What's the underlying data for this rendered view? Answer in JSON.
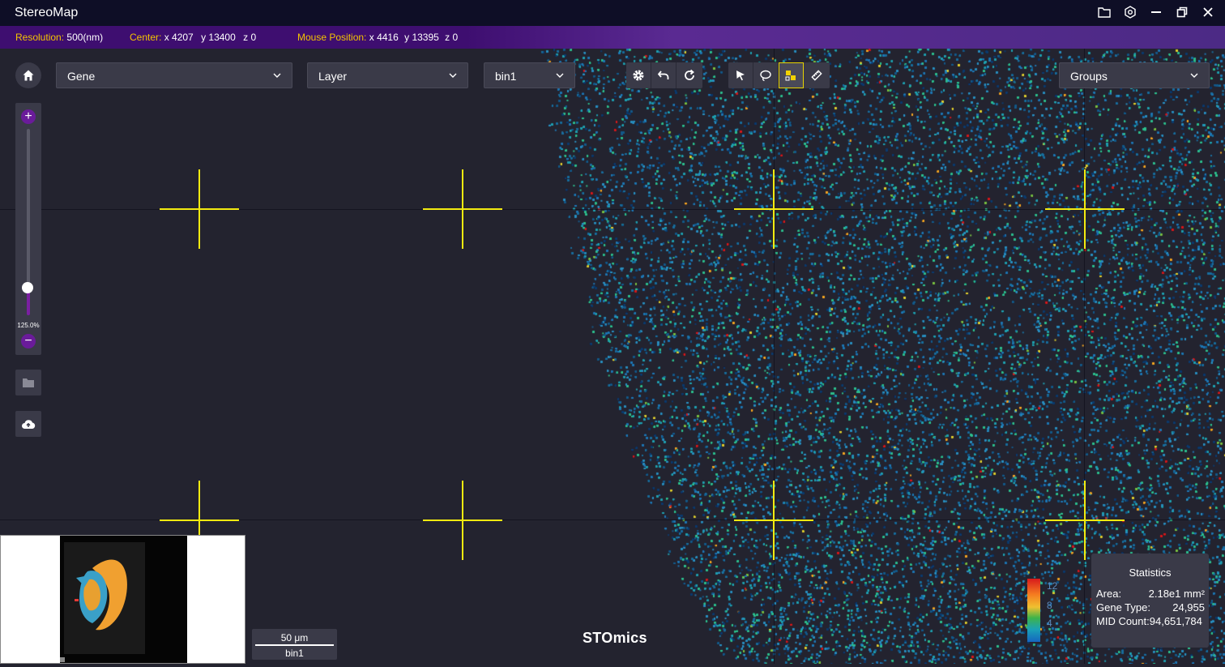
{
  "app": {
    "title": "StereoMap"
  },
  "window_controls": {
    "icons": [
      "folder-icon",
      "settings-icon",
      "minimize-icon",
      "restore-icon",
      "close-icon"
    ]
  },
  "infobar": {
    "resolution_label": "Resolution:",
    "resolution_value": "500(nm)",
    "center_label": "Center:",
    "center_x": "x 4207",
    "center_y": "y 13400",
    "center_z": "z 0",
    "mouse_label": "Mouse Position:",
    "mouse_x": "x 4416",
    "mouse_y": "y 13395",
    "mouse_z": "z 0"
  },
  "controls": {
    "gene_select": "Gene",
    "layer_select": "Layer",
    "bin_select": "bin1",
    "groups_select": "Groups"
  },
  "zoom": {
    "percent_label": "125.0%",
    "level_fraction": 0.125
  },
  "scalebar": {
    "length_label": "50 μm",
    "bin_label": "bin1"
  },
  "brand": "STOmics",
  "legend": {
    "ticks": [
      "12",
      "8",
      "4"
    ]
  },
  "statistics": {
    "title": "Statistics",
    "area_label": "Area:",
    "area_value": "2.18e1 mm²",
    "gene_type_label": "Gene Type:",
    "gene_type_value": "24,955",
    "mid_count_label": "MID Count:",
    "mid_count_value": "94,651,784"
  },
  "colors": {
    "accent": "#6a1b9a",
    "crosshair": "#f2ea10",
    "info_label": "#f4c400"
  }
}
